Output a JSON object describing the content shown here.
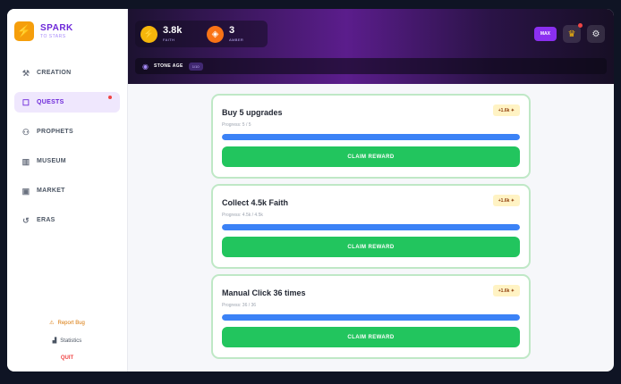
{
  "brand": {
    "name": "SPARK",
    "subtitle": "TO STARS"
  },
  "sidebar": {
    "items": [
      {
        "label": "CREATION",
        "icon": "hammer-icon",
        "active": false
      },
      {
        "label": "QUESTS",
        "icon": "quest-scroll-icon",
        "active": true,
        "has_notification": true
      },
      {
        "label": "PROPHETS",
        "icon": "people-icon",
        "active": false
      },
      {
        "label": "MUSEUM",
        "icon": "museum-icon",
        "active": false
      },
      {
        "label": "MARKET",
        "icon": "shop-icon",
        "active": false
      },
      {
        "label": "ERAS",
        "icon": "history-icon",
        "active": false
      }
    ],
    "footer": {
      "report": "Report Bug",
      "stats": "Statistics",
      "quit": "QUIT"
    }
  },
  "resources": {
    "faith": {
      "value": "3.8k",
      "label": "FAITH"
    },
    "amber": {
      "value": "3",
      "label": "AMBER"
    }
  },
  "header": {
    "max_label": "MAX"
  },
  "era": {
    "name": "STONE AGE",
    "tag": "1/10"
  },
  "quests": [
    {
      "title": "Buy 5 upgrades",
      "progress": "Progress: 5 / 5",
      "reward": "+1.6k ✦",
      "progress_fraction": 1.0,
      "button": "CLAIM REWARD"
    },
    {
      "title": "Collect 4.5k Faith",
      "progress": "Progress: 4.5k / 4.5k",
      "reward": "+1.6k ✦",
      "progress_fraction": 1.0,
      "button": "CLAIM REWARD"
    },
    {
      "title": "Manual Click 36 times",
      "progress": "Progress: 36 / 36",
      "reward": "+1.6k ✦",
      "progress_fraction": 1.0,
      "button": "CLAIM REWARD"
    }
  ],
  "colors": {
    "accent": "#6d28d9",
    "claim": "#22c55e",
    "progress": "#3b82f6",
    "quest_border": "#bfe8c6"
  }
}
